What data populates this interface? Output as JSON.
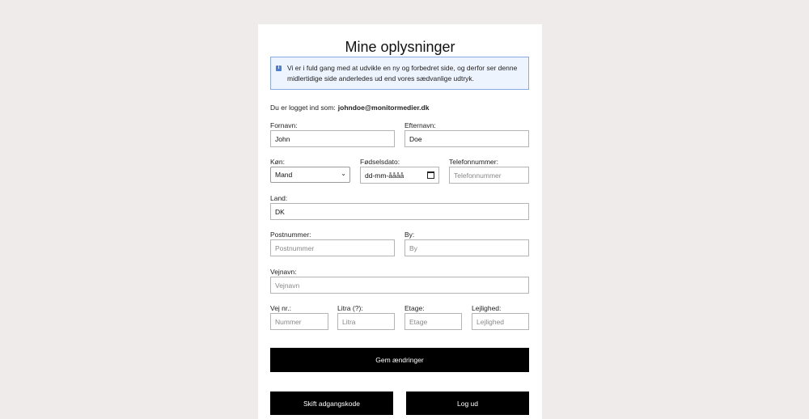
{
  "title": "Mine oplysninger",
  "notice": {
    "icon": "info-icon",
    "text": "Vi er i fuld gang med at udvikle en ny og forbedret side, og derfor ser denne midlertidige side anderledes ud end vores sædvanlige udtryk."
  },
  "logged_in": {
    "label": "Du er logget ind som:",
    "email": "johndoe@monitormedier.dk"
  },
  "fields": {
    "fornavn": {
      "label": "Fornavn:",
      "value": "John",
      "placeholder": ""
    },
    "efternavn": {
      "label": "Efternavn:",
      "value": "Doe",
      "placeholder": ""
    },
    "kon": {
      "label": "Køn:",
      "value": "Mand"
    },
    "fodselsdato": {
      "label": "Fødselsdato:",
      "value": "dd-mm-åååå"
    },
    "telefon": {
      "label": "Telefonnummer:",
      "value": "",
      "placeholder": "Telefonnummer"
    },
    "land": {
      "label": "Land:",
      "value": "DK",
      "placeholder": ""
    },
    "postnummer": {
      "label": "Postnummer:",
      "value": "",
      "placeholder": "Postnummer"
    },
    "by": {
      "label": "By:",
      "value": "",
      "placeholder": "By"
    },
    "vejnavn": {
      "label": "Vejnavn:",
      "value": "",
      "placeholder": "Vejnavn"
    },
    "vejnr": {
      "label": "Vej nr.:",
      "value": "",
      "placeholder": "Nummer"
    },
    "litra": {
      "label": "Litra (?):",
      "value": "",
      "placeholder": "Litra"
    },
    "etage": {
      "label": "Etage:",
      "value": "",
      "placeholder": "Etage"
    },
    "lejlighed": {
      "label": "Lejlighed:",
      "value": "",
      "placeholder": "Lejlighed"
    }
  },
  "buttons": {
    "save": "Gem ændringer",
    "change_password": "Skift adgangskode",
    "logout": "Log ud"
  },
  "colors": {
    "background": "#efebea",
    "notice_border": "#8aa9e8",
    "notice_bg": "#eef4fd",
    "button": "#000000"
  }
}
